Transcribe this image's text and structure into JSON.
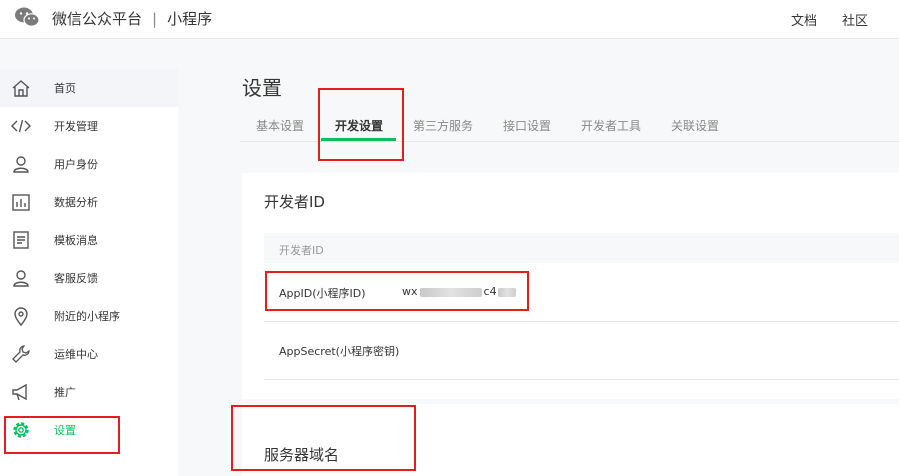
{
  "header": {
    "brand": "微信公众平台",
    "separator": "|",
    "product": "小程序",
    "links": [
      "文档",
      "社区"
    ]
  },
  "sidebar": {
    "items": [
      {
        "label": "首页",
        "icon": "home-icon"
      },
      {
        "label": "开发管理",
        "icon": "code-icon"
      },
      {
        "label": "用户身份",
        "icon": "user-icon"
      },
      {
        "label": "数据分析",
        "icon": "chart-icon"
      },
      {
        "label": "模板消息",
        "icon": "document-icon"
      },
      {
        "label": "客服反馈",
        "icon": "support-icon"
      },
      {
        "label": "附近的小程序",
        "icon": "location-icon"
      },
      {
        "label": "运维中心",
        "icon": "wrench-icon"
      },
      {
        "label": "推广",
        "icon": "megaphone-icon"
      },
      {
        "label": "设置",
        "icon": "gear-icon"
      }
    ]
  },
  "main": {
    "title": "设置",
    "tabs": [
      "基本设置",
      "开发设置",
      "第三方服务",
      "接口设置",
      "开发者工具",
      "关联设置"
    ],
    "active_tab": "开发设置",
    "developer_card": {
      "title": "开发者ID",
      "table_header": "开发者ID",
      "rows": [
        {
          "key": "AppID(小程序ID)",
          "value_prefix": "wx",
          "value_mid": "c4"
        },
        {
          "key": "AppSecret(小程序密钥)"
        }
      ]
    },
    "server_card": {
      "title": "服务器域名"
    }
  },
  "colors": {
    "accent": "#07c160",
    "highlight_box": "#e41d1d"
  }
}
